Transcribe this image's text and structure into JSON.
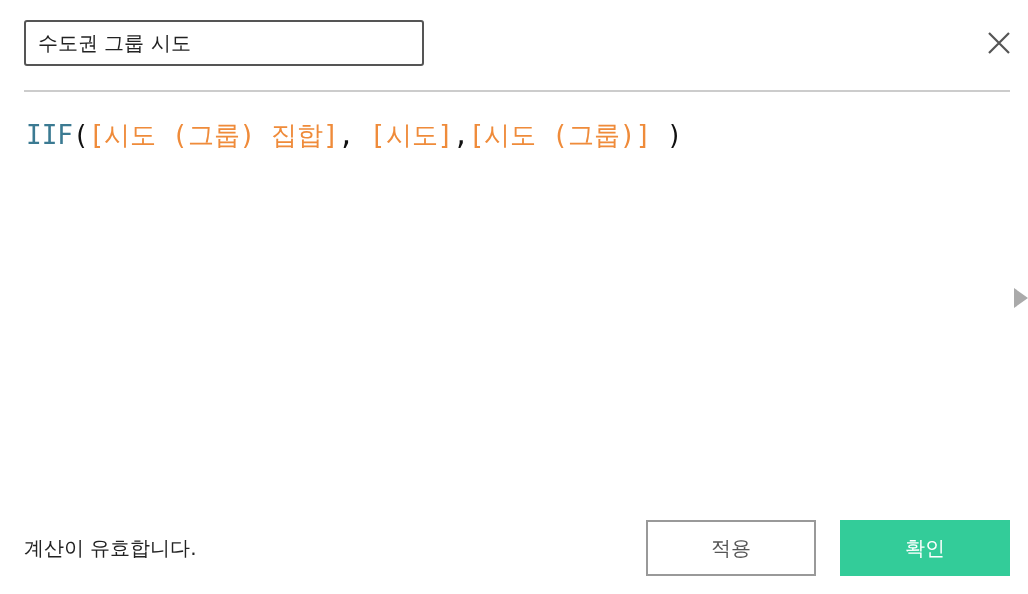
{
  "calculation_name": {
    "value": "수도권 그룹 시도"
  },
  "formula": [
    {
      "kind": "function",
      "text": "IIF"
    },
    {
      "kind": "punct",
      "text": "("
    },
    {
      "kind": "field",
      "text": "[시도 (그룹) 집합]"
    },
    {
      "kind": "punct",
      "text": ", "
    },
    {
      "kind": "field",
      "text": "[시도]"
    },
    {
      "kind": "punct",
      "text": ","
    },
    {
      "kind": "field",
      "text": "[시도 (그룹)]"
    },
    {
      "kind": "punct",
      "text": " )"
    }
  ],
  "status": "계산이 유효합니다.",
  "buttons": [
    {
      "kind": "secondary",
      "label": "적용"
    },
    {
      "kind": "primary",
      "label": "확인"
    }
  ]
}
